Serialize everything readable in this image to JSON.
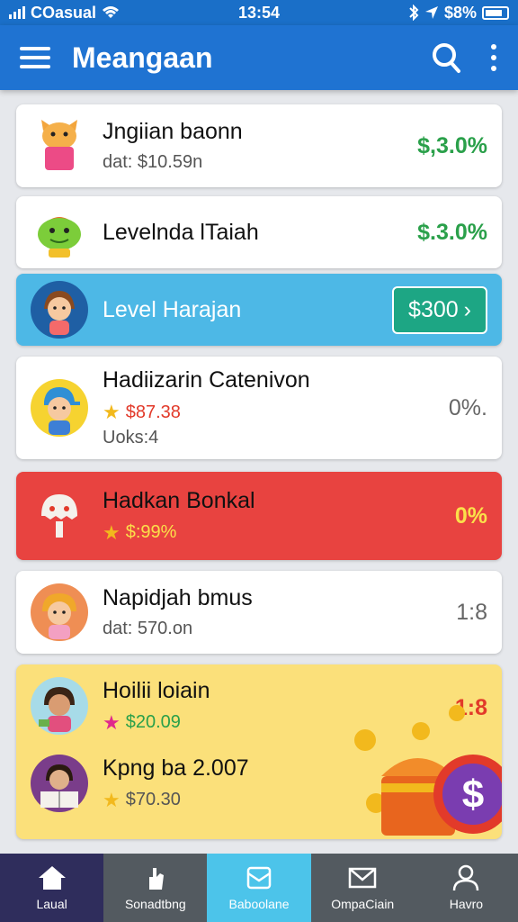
{
  "status": {
    "carrier": "COasual",
    "time": "13:54",
    "battery_text": "$8%"
  },
  "app": {
    "title": "Meangaan"
  },
  "items": [
    {
      "title": "Jngiian baonn",
      "sub": "dat: $10.59n",
      "amount": "$,3.0%",
      "icon": "cat-icon"
    },
    {
      "title": "Levelnda lTaiah",
      "amount": "$.3.0%",
      "icon": "frog-icon"
    },
    {
      "title": "Level Harajan",
      "cta": "$300",
      "icon": "girl-avatar"
    },
    {
      "title": "Hadiizarin Catenivon",
      "price": "$87.38",
      "sub2": "Uoks:4",
      "amount": "0%.",
      "icon": "boy-avatar"
    },
    {
      "title": "Hadkan Bonkal",
      "price": "$:99%",
      "amount": "0%",
      "icon": "ghost-icon"
    },
    {
      "title": "Napidjah bmus",
      "sub": "dat: 570.on",
      "amount": "1:8",
      "icon": "lady-avatar"
    },
    {
      "title": "Hoilii loiain",
      "price": "$20.09",
      "amount": "1:8",
      "icon": "woman-avatar"
    },
    {
      "title": "Kpng ba 2.007",
      "price": "$70.30",
      "icon": "reader-avatar"
    }
  ],
  "nav": [
    {
      "label": "Laual",
      "icon": "home-icon"
    },
    {
      "label": "Sonadtbng",
      "icon": "hand-icon"
    },
    {
      "label": "Baboolane",
      "icon": "box-icon"
    },
    {
      "label": "OmpaCiain",
      "icon": "mail-icon"
    },
    {
      "label": "Havro",
      "icon": "profile-icon"
    }
  ],
  "colors": {
    "primary": "#1f73d2",
    "highlight_card": "#4db8e6",
    "alert_card": "#e84340",
    "promo_card": "#fbe07a",
    "cta": "#1da684"
  }
}
